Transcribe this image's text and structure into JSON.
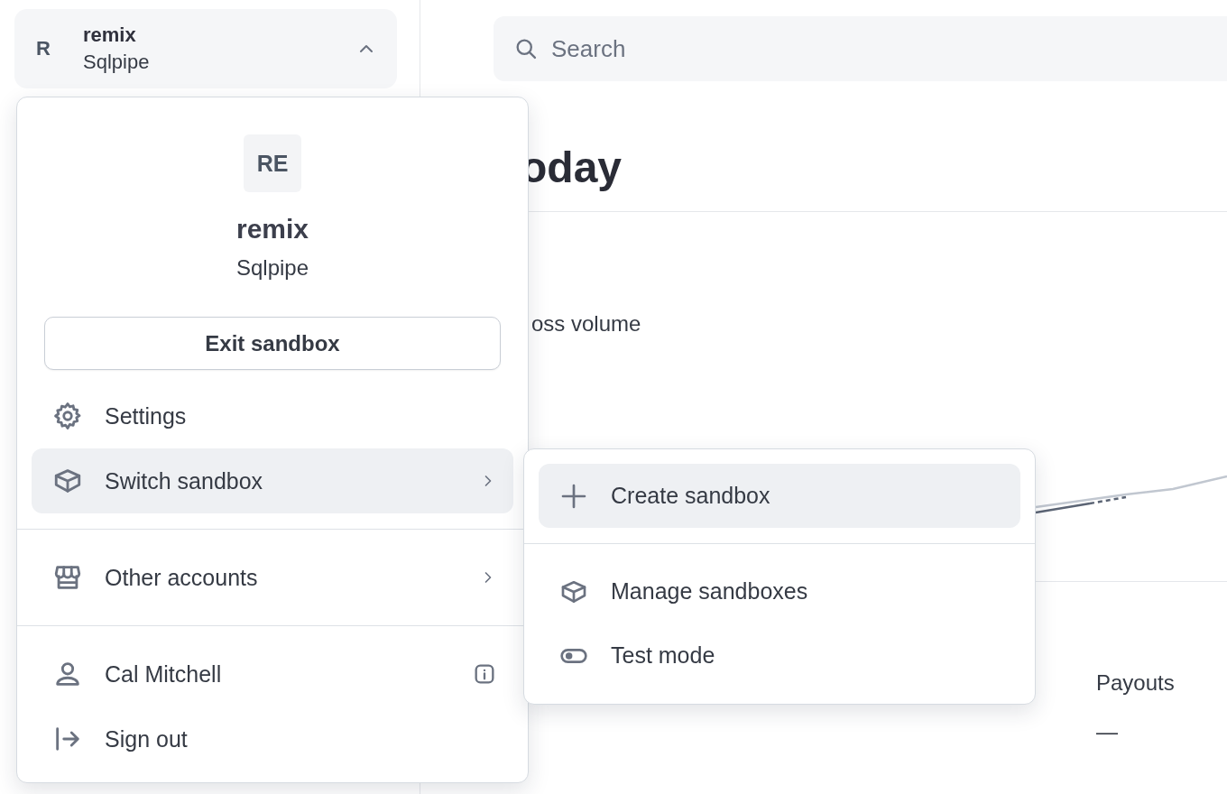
{
  "account_switcher": {
    "initial": "R",
    "name": "remix",
    "subtitle": "Sqlpipe",
    "expanded": true
  },
  "search": {
    "placeholder": "Search"
  },
  "page": {
    "heading": "oday",
    "metric_label": "oss volume",
    "payouts_label": "Payouts",
    "payouts_value": "—"
  },
  "account_menu": {
    "avatar": "RE",
    "name": "remix",
    "subtitle": "Sqlpipe",
    "exit_button": "Exit sandbox",
    "groups": [
      {
        "items": [
          {
            "label": "Settings",
            "highlighted": false,
            "has_submenu": false
          },
          {
            "label": "Switch sandbox",
            "highlighted": true,
            "has_submenu": true
          }
        ]
      },
      {
        "items": [
          {
            "label": "Other accounts",
            "highlighted": false,
            "has_submenu": true
          }
        ]
      },
      {
        "items": [
          {
            "label": "Cal Mitchell",
            "highlighted": false,
            "has_submenu": false
          },
          {
            "label": "Sign out",
            "highlighted": false,
            "has_submenu": false
          }
        ]
      }
    ]
  },
  "sandbox_submenu": {
    "groups": [
      {
        "items": [
          {
            "label": "Create sandbox",
            "highlighted": true,
            "has_submenu": false
          }
        ]
      },
      {
        "items": [
          {
            "label": "Manage sandboxes",
            "highlighted": false,
            "has_submenu": false
          },
          {
            "label": "Test mode",
            "highlighted": false,
            "has_submenu": false
          }
        ]
      }
    ]
  }
}
